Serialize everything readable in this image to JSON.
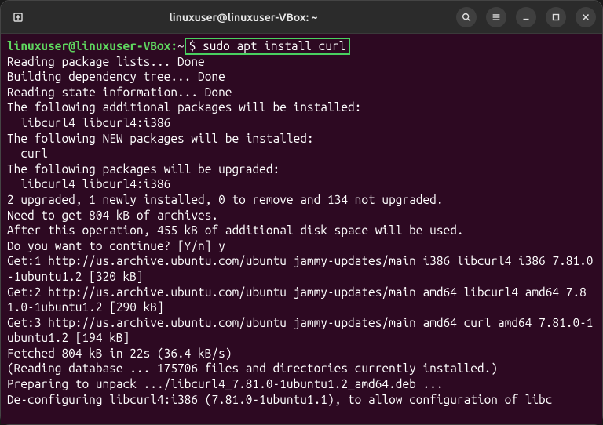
{
  "titlebar": {
    "title": "linuxuser@linuxuser-VBox: ~"
  },
  "prompt": {
    "userhost": "linuxuser@linuxuser-VBox:",
    "path_sep": "~",
    "dollar": "$",
    "command": "sudo apt install curl"
  },
  "lines": {
    "l0": "Reading package lists... Done",
    "l1": "Building dependency tree... Done",
    "l2": "Reading state information... Done",
    "l3": "The following additional packages will be installed:",
    "l4": "  libcurl4 libcurl4:i386",
    "l5": "The following NEW packages will be installed:",
    "l6": "  curl",
    "l7": "The following packages will be upgraded:",
    "l8": "  libcurl4 libcurl4:i386",
    "l9": "2 upgraded, 1 newly installed, 0 to remove and 134 not upgraded.",
    "l10": "Need to get 804 kB of archives.",
    "l11": "After this operation, 455 kB of additional disk space will be used.",
    "l12": "Do you want to continue? [Y/n] y",
    "l13": "Get:1 http://us.archive.ubuntu.com/ubuntu jammy-updates/main i386 libcurl4 i386 7.81.0-1ubuntu1.2 [320 kB]",
    "l14": "Get:2 http://us.archive.ubuntu.com/ubuntu jammy-updates/main amd64 libcurl4 amd64 7.81.0-1ubuntu1.2 [290 kB]",
    "l15": "Get:3 http://us.archive.ubuntu.com/ubuntu jammy-updates/main amd64 curl amd64 7.81.0-1ubuntu1.2 [194 kB]",
    "l16": "Fetched 804 kB in 22s (36.4 kB/s)",
    "l17": "(Reading database ... 175706 files and directories currently installed.)",
    "l18": "Preparing to unpack .../libcurl4_7.81.0-1ubuntu1.2_amd64.deb ...",
    "l19": "De-configuring libcurl4:i386 (7.81.0-1ubuntu1.1), to allow configuration of libc"
  }
}
